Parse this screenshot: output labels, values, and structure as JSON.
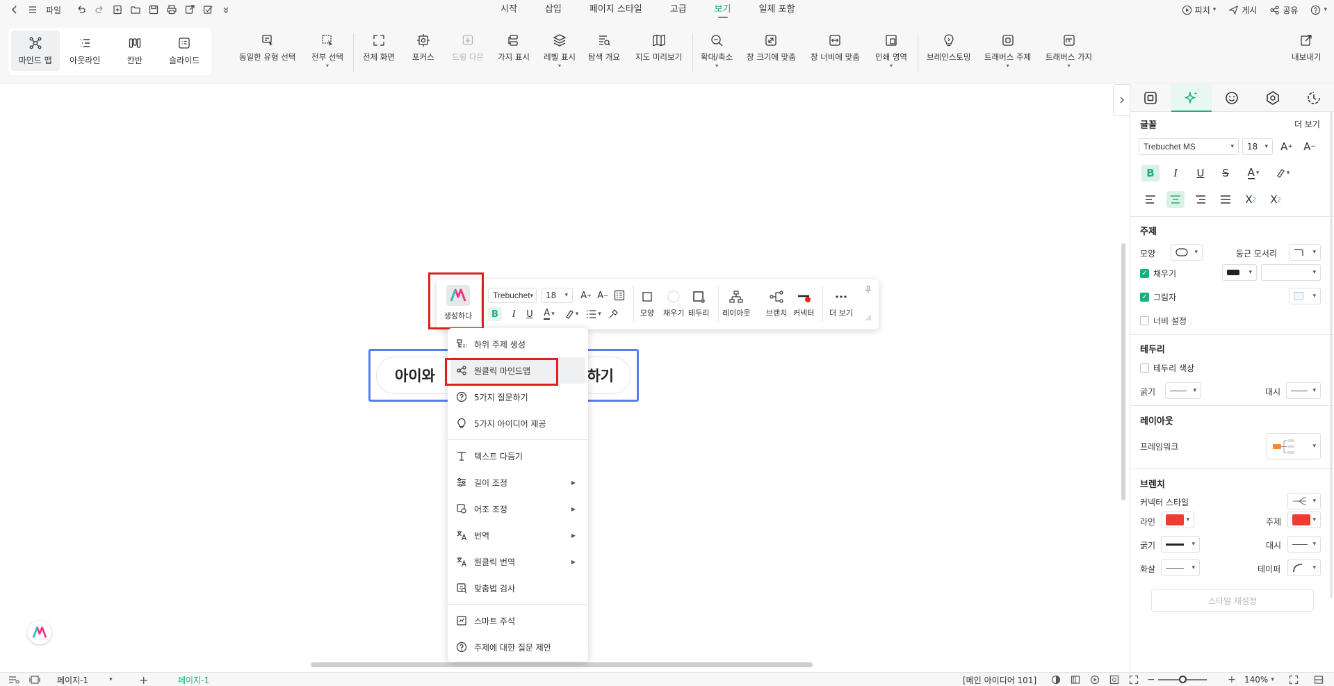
{
  "menubar": {
    "file_label": "파일",
    "tabs": [
      "시작",
      "삽입",
      "페이지 스타일",
      "고급",
      "보기",
      "일체 포함"
    ],
    "active_tab": "보기",
    "right": {
      "pitch": "피치",
      "publish": "게시",
      "share": "공유"
    }
  },
  "ribbon": {
    "views": [
      {
        "label": "마인드 맵",
        "icon": "mindmap-icon"
      },
      {
        "label": "아웃라인",
        "icon": "outline-icon"
      },
      {
        "label": "칸반",
        "icon": "kanban-icon"
      },
      {
        "label": "슬라이드",
        "icon": "slide-icon"
      }
    ],
    "buttons": [
      "동일한 유형 선택",
      "전부 선택",
      "전체 화면",
      "포커스",
      "드릴 다운",
      "가지 표시",
      "레벨 표시",
      "탐색 개요",
      "지도 미리보기",
      "확대/축소",
      "창 크기에 맞춤",
      "창 너비에 맞춤",
      "인쇄 영역",
      "브레인스토밍",
      "트래버스 주제",
      "트래버스 가지"
    ],
    "export_label": "내보내기"
  },
  "canvas": {
    "topic_text": "아이와 어떻게 효과적으로 소통하기",
    "topic_visible_left": "아이와 ",
    "topic_visible_right": "하기"
  },
  "floating_toolbar": {
    "generate_label": "생성하다",
    "font": "Trebuchet",
    "size": "18",
    "buttons": [
      "모양",
      "채우기",
      "테두리",
      "레이아웃",
      "브랜치",
      "커넥터",
      "더 보기"
    ]
  },
  "ai_menu": {
    "items": [
      {
        "label": "하위 주제 생성",
        "icon": "subtopic-icon",
        "submenu": false
      },
      {
        "label": "원클릭 마인드맵",
        "icon": "mindmap-icon",
        "submenu": false,
        "highlighted": true
      },
      {
        "label": "5가지 질문하기",
        "icon": "question-icon",
        "submenu": false
      },
      {
        "label": "5가지 아이디어 제공",
        "icon": "idea-icon",
        "submenu": false
      },
      {
        "label": "텍스트 다듬기",
        "icon": "text-refine-icon",
        "submenu": false
      },
      {
        "label": "길이 조정",
        "icon": "length-icon",
        "submenu": true
      },
      {
        "label": "어조 조정",
        "icon": "tone-icon",
        "submenu": true
      },
      {
        "label": "번역",
        "icon": "translate-icon",
        "submenu": true
      },
      {
        "label": "원클릭 번역",
        "icon": "translate-icon",
        "submenu": true
      },
      {
        "label": "맞춤법 검사",
        "icon": "spellcheck-icon",
        "submenu": false
      },
      {
        "label": "스마트 주석",
        "icon": "note-icon",
        "submenu": false
      },
      {
        "label": "주제에 대한 질문 제안",
        "icon": "question-icon",
        "submenu": false
      }
    ]
  },
  "statusbar": {
    "page_select": "페이지-1",
    "page_tab": "페이지-1",
    "main_idea": "[메인 아이디어 101]",
    "zoom": "140%"
  },
  "panel": {
    "font_section": "글꼴",
    "more": "더 보기",
    "font_family": "Trebuchet MS",
    "font_size": "18",
    "topic_section": "주제",
    "shape_label": "모양",
    "corner_label": "둥근 모서리",
    "fill_label": "채우기",
    "shadow_label": "그림자",
    "width_label": "너비 설정",
    "border_section": "테두리",
    "border_color_label": "테두리 색상",
    "thickness_label": "굵기",
    "dash_label": "대시",
    "layout_section": "레이아웃",
    "framework_label": "프레임워크",
    "branch_section": "브렌치",
    "connector_style_label": "커넥터 스타일",
    "line_label": "라인",
    "topic_label": "주제",
    "thickness2_label": "굵기",
    "dash2_label": "대시",
    "arrow_label": "화살",
    "taper_label": "테이퍼",
    "reset_label": "스타일 재설정",
    "colors": {
      "accent": "#1aaf7f",
      "line": "#f23b30",
      "topic": "#f23b30",
      "fill": "#222222"
    }
  }
}
